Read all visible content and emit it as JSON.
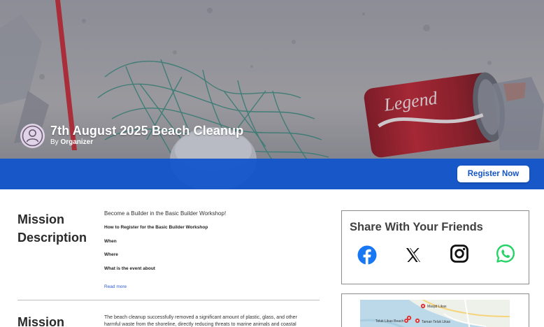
{
  "event": {
    "title": "7th August 2025 Beach Cleanup",
    "by_prefix": "By",
    "organizer": "Organizer",
    "register_label": "Register Now",
    "can_label": "Legend"
  },
  "mission_description": {
    "heading_line1": "Mission",
    "heading_line2": "Description",
    "intro": "Become a Builder in the Basic Builder Workshop!",
    "items": [
      "How to Register for the Basic Builder Workshop",
      "When",
      "Where",
      "What is the event about"
    ],
    "read_more": "Read more"
  },
  "mission_impact": {
    "heading_line1": "Mission",
    "text": "The beach cleanup successfully removed a significant amount of plastic, glass, and other harmful waste from the shoreline, directly reducing threats to marine animals and coastal"
  },
  "share": {
    "title": "Share With Your Friends",
    "icons": [
      "facebook-icon",
      "x-icon",
      "instagram-icon",
      "whatsapp-icon"
    ]
  },
  "map": {
    "labels": [
      "Masjid Likas",
      "Teluk Likas Beach",
      "Taman Teluk Likas"
    ]
  },
  "colors": {
    "brand_blue": "#1354c8",
    "facebook": "#1877f2",
    "whatsapp": "#25d366"
  }
}
